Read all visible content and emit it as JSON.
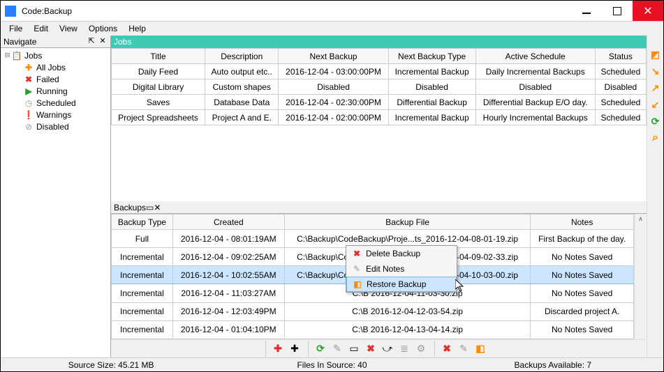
{
  "window": {
    "title": "Code:Backup"
  },
  "menubar": [
    "File",
    "Edit",
    "View",
    "Options",
    "Help"
  ],
  "navigate": {
    "header": "Navigate",
    "root": "Jobs",
    "items": [
      {
        "label": "All Jobs",
        "icon": "✚",
        "cls": "ic-orange"
      },
      {
        "label": "Failed",
        "icon": "✖",
        "cls": "ic-red"
      },
      {
        "label": "Running",
        "icon": "▶",
        "cls": "ic-green"
      },
      {
        "label": "Scheduled",
        "icon": "◷",
        "cls": "ic-grey"
      },
      {
        "label": "Warnings",
        "icon": "❗",
        "cls": "ic-orange"
      },
      {
        "label": "Disabled",
        "icon": "⊘",
        "cls": "ic-grey"
      }
    ]
  },
  "jobs": {
    "header": "Jobs",
    "columns": [
      "Title",
      "Description",
      "Next Backup",
      "Next Backup Type",
      "Active Schedule",
      "Status"
    ],
    "rows": [
      [
        "Daily Feed",
        "Auto output etc..",
        "2016-12-04 - 03:00:00PM",
        "Incremental Backup",
        "Daily Incremental Backups",
        "Scheduled"
      ],
      [
        "Digital Library",
        "Custom shapes",
        "Disabled",
        "Disabled",
        "Disabled",
        "Disabled"
      ],
      [
        "Saves",
        "Database Data",
        "2016-12-04 - 02:30:00PM",
        "Differential Backup",
        "Differential Backup E/O day.",
        "Scheduled"
      ],
      [
        "Project Spreadsheets",
        "Project A and E.",
        "2016-12-04 - 02:00:00PM",
        "Incremental Backup",
        "Hourly Incremental Backups",
        "Scheduled"
      ]
    ]
  },
  "backups": {
    "header": "Backups",
    "columns": [
      "Backup Type",
      "Created",
      "Backup File",
      "Notes"
    ],
    "rows": [
      [
        "Full",
        "2016-12-04 - 08:01:19AM",
        "C:\\Backup\\CodeBackup\\Proje...ts_2016-12-04-08-01-19.zip",
        "First Backup of the day."
      ],
      [
        "Incremental",
        "2016-12-04 - 09:02:25AM",
        "C:\\Backup\\CodeBackup\\Proje...ts_2016-12-04-09-02-33.zip",
        "No Notes Saved"
      ],
      [
        "Incremental",
        "2016-12-04 - 10:02:55AM",
        "C:\\Backup\\CodeBackup\\Proje...ts_2016-12-04-10-03-00.zip",
        "No Notes Saved"
      ],
      [
        "Incremental",
        "2016-12-04 - 11:03:27AM",
        "C:\\B                                               2016-12-04-11-03-30.zip",
        "No Notes Saved"
      ],
      [
        "Incremental",
        "2016-12-04 - 12:03:49PM",
        "C:\\B                                               2016-12-04-12-03-54.zip",
        "Discarded project A."
      ],
      [
        "Incremental",
        "2016-12-04 - 01:04:10PM",
        "C:\\B                                               2016-12-04-13-04-14.zip",
        "No Notes Saved"
      ]
    ],
    "selected": 2
  },
  "context_menu": {
    "items": [
      {
        "label": "Delete Backup",
        "icon": "✖",
        "cls": "ic-red"
      },
      {
        "label": "Edit Notes",
        "icon": "✎",
        "cls": "ic-grey"
      },
      {
        "label": "Restore Backup",
        "icon": "◧",
        "cls": "ic-orange"
      }
    ],
    "hover": 2
  },
  "statusbar": {
    "source_size": "Source Size: 45.21 MB",
    "files_in_source": "Files In Source: 40",
    "backups_available": "Backups Available: 7"
  }
}
